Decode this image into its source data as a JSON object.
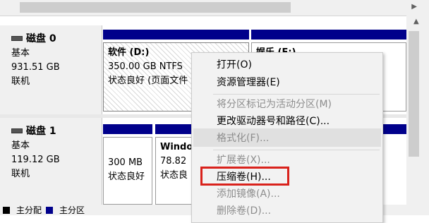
{
  "disks": [
    {
      "title": "磁盘 0",
      "type": "基本",
      "size": "931.51 GB",
      "status": "联机",
      "volumes": [
        {
          "name": "软件  (D:)",
          "size": "350.00 GB NTFS",
          "status": "状态良好 (页面文件"
        },
        {
          "name": "娱乐  (E:)",
          "size": "",
          "status": ""
        }
      ]
    },
    {
      "title": "磁盘 1",
      "type": "基本",
      "size": "119.12 GB",
      "status": "联机",
      "volumes": [
        {
          "name": "",
          "size": "300 MB",
          "status": "状态良好"
        },
        {
          "name": "Windo",
          "size": "78.82",
          "status": "状态良"
        }
      ]
    }
  ],
  "legend": {
    "primary_partition": "主分配",
    "primary_partition_2": "主分区"
  },
  "context_menu": {
    "open": "打开(O)",
    "explorer": "资源管理器(E)",
    "mark_active": "将分区标记为活动分区(M)",
    "change_letter": "更改驱动器号和路径(C)...",
    "format": "格式化(F)...",
    "extend": "扩展卷(X)...",
    "shrink": "压缩卷(H)...",
    "add_mirror": "添加镜像(A)...",
    "delete": "删除卷(D)..."
  },
  "colors": {
    "partition_strip": "#00008b",
    "highlight": "#d9221c"
  }
}
